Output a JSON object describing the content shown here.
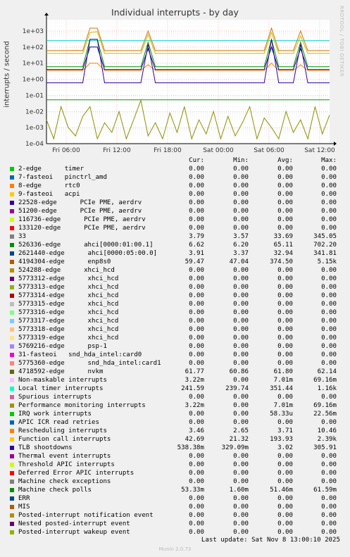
{
  "title": "Individual interrupts - by day",
  "ylabel": "interrupts / second",
  "watermark": "RRDTOOL / TOBI OETIKER",
  "footer": "Last update: Sat Nov  8 13:00:10 2025",
  "munin": "Munin 2.0.73",
  "chart_data": {
    "type": "line",
    "title": "Individual interrupts - by day",
    "ylabel": "interrupts / second",
    "yscale": "log",
    "ylim": [
      0.0001,
      5000
    ],
    "y_ticks": [
      "1e-04",
      "1e-03",
      "1e-02",
      "1e-01",
      "1e+00",
      "1e+01",
      "1e+02",
      "1e+03"
    ],
    "x_ticks": [
      "Fri 06:00",
      "Fri 12:00",
      "Fri 18:00",
      "Sat 00:00",
      "Sat 06:00",
      "Sat 12:00"
    ],
    "grid": true,
    "series": [
      {
        "name": "4194304-edge enp8s0",
        "color": "#CC7700",
        "values": [
          60,
          60,
          60,
          60,
          62,
          60,
          1500,
          1500,
          60,
          60,
          60,
          60,
          60,
          60,
          1000,
          60,
          60,
          60,
          60,
          60,
          60,
          60,
          60,
          60,
          60,
          60,
          60,
          60,
          60,
          60,
          60,
          1500,
          60,
          60,
          60,
          1000,
          60,
          60,
          60,
          60
        ]
      },
      {
        "name": "Local timer interrupts",
        "color": "#00CCCC",
        "values": [
          250,
          250,
          250,
          250,
          250,
          250,
          250,
          250,
          250,
          250,
          250,
          250,
          250,
          250,
          250,
          250,
          250,
          250,
          250,
          250,
          250,
          250,
          250,
          250,
          250,
          250,
          250,
          250,
          250,
          250,
          250,
          250,
          250,
          250,
          250,
          250,
          250,
          250,
          250,
          250
        ]
      },
      {
        "name": "Function call interrupts",
        "color": "#CCBB00",
        "values": [
          40,
          40,
          40,
          40,
          40,
          40,
          800,
          900,
          40,
          40,
          40,
          40,
          40,
          40,
          600,
          40,
          40,
          40,
          40,
          40,
          40,
          40,
          40,
          40,
          40,
          40,
          40,
          40,
          40,
          40,
          40,
          800,
          40,
          40,
          40,
          500,
          40,
          40,
          40,
          40
        ]
      },
      {
        "name": "526336-edge ahci[0000:01:00.1]",
        "color": "#008F00",
        "values": [
          6,
          6,
          6,
          6,
          6,
          6,
          300,
          300,
          6,
          6,
          6,
          6,
          6,
          6,
          200,
          6,
          6,
          6,
          6,
          6,
          6,
          6,
          6,
          6,
          6,
          6,
          6,
          6,
          6,
          6,
          6,
          300,
          6,
          6,
          6,
          200,
          6,
          6,
          6,
          6
        ]
      },
      {
        "name": "33",
        "color": "#00007F",
        "values": [
          4,
          4,
          4,
          4,
          4,
          4,
          100,
          100,
          4,
          4,
          4,
          4,
          4,
          4,
          80,
          4,
          4,
          4,
          4,
          4,
          4,
          4,
          4,
          4,
          4,
          4,
          4,
          4,
          4,
          4,
          4,
          100,
          4,
          4,
          4,
          80,
          4,
          4,
          4,
          4
        ]
      },
      {
        "name": "Rescheduling interrupts",
        "color": "#FF8000",
        "values": [
          3.5,
          3.5,
          3.5,
          3.5,
          3.5,
          3.5,
          10,
          10,
          3.5,
          3.5,
          3.5,
          3.5,
          3.5,
          3.5,
          8,
          3.5,
          3.5,
          3.5,
          3.5,
          3.5,
          3.5,
          3.5,
          3.5,
          3.5,
          3.5,
          3.5,
          3.5,
          3.5,
          3.5,
          3.5,
          3.5,
          10,
          3.5,
          3.5,
          3.5,
          8,
          3.5,
          3.5,
          3.5,
          3.5
        ]
      },
      {
        "name": "TLB shootdowns",
        "color": "#330099",
        "values": [
          0.6,
          0.6,
          0.6,
          0.6,
          0.6,
          0.6,
          300,
          300,
          0.6,
          0.6,
          0.6,
          0.6,
          0.6,
          0.6,
          150,
          0.6,
          0.6,
          0.6,
          0.6,
          0.6,
          0.6,
          0.6,
          0.6,
          0.6,
          0.6,
          0.6,
          0.6,
          0.6,
          0.6,
          0.6,
          0.6,
          300,
          0.6,
          0.6,
          0.6,
          150,
          0.6,
          0.6,
          0.6,
          0.6
        ]
      },
      {
        "name": "Machine check polls",
        "color": "#00A000",
        "values": [
          0.053,
          0.053,
          0.053,
          0.053,
          0.053,
          0.053,
          0.053,
          0.053,
          0.053,
          0.053,
          0.053,
          0.053,
          0.053,
          0.053,
          0.053,
          0.053,
          0.053,
          0.053,
          0.053,
          0.053,
          0.053,
          0.053,
          0.053,
          0.053,
          0.053,
          0.053,
          0.053,
          0.053,
          0.053,
          0.053,
          0.053,
          0.053,
          0.053,
          0.053,
          0.053,
          0.053,
          0.053,
          0.053,
          0.053,
          0.053
        ]
      },
      {
        "name": "Performance monitoring interrupts",
        "color": "#8F8F00",
        "values": [
          0.003,
          0.0002,
          0.02,
          0.001,
          0.0003,
          0.005,
          0.02,
          0.0002,
          0.002,
          0.0005,
          0.01,
          0.0002,
          0.003,
          0.05,
          0.0003,
          0.002,
          0.0002,
          0.008,
          0.0005,
          0.02,
          0.0002,
          0.003,
          0.0004,
          0.01,
          0.0002,
          0.005,
          0.0003,
          0.002,
          0.02,
          0.0002,
          0.004,
          0.001,
          0.0002,
          0.01,
          0.0005,
          0.003,
          0.0002,
          0.02,
          0.0004,
          0.006
        ]
      }
    ]
  },
  "legend": {
    "headers": [
      "Cur:",
      "Min:",
      "Avg:",
      "Max:"
    ],
    "rows": [
      {
        "color": "#00CC00",
        "label": "2-edge      timer",
        "cur": "0.00",
        "min": "0.00",
        "avg": "0.00",
        "max": "0.00"
      },
      {
        "color": "#0066B3",
        "label": "7-fasteoi   pinctrl_amd",
        "cur": "0.00",
        "min": "0.00",
        "avg": "0.00",
        "max": "0.00"
      },
      {
        "color": "#FF8000",
        "label": "8-edge      rtc0",
        "cur": "0.00",
        "min": "0.00",
        "avg": "0.00",
        "max": "0.00"
      },
      {
        "color": "#FFCC00",
        "label": "9-fasteoi   acpi",
        "cur": "0.00",
        "min": "0.00",
        "avg": "0.00",
        "max": "0.00"
      },
      {
        "color": "#330099",
        "label": "22528-edge      PCIe PME, aerdrv",
        "cur": "0.00",
        "min": "0.00",
        "avg": "0.00",
        "max": "0.00"
      },
      {
        "color": "#990099",
        "label": "51200-edge      PCIe PME, aerdrv",
        "cur": "0.00",
        "min": "0.00",
        "avg": "0.00",
        "max": "0.00"
      },
      {
        "color": "#CCFF00",
        "label": "116736-edge      PCIe PME, aerdrv",
        "cur": "0.00",
        "min": "0.00",
        "avg": "0.00",
        "max": "0.00"
      },
      {
        "color": "#FF0000",
        "label": "133120-edge      PCIe PME, aerdrv",
        "cur": "0.00",
        "min": "0.00",
        "avg": "0.00",
        "max": "0.00"
      },
      {
        "color": "#808080",
        "label": "33",
        "cur": "3.79",
        "min": "3.57",
        "avg": "33.69",
        "max": "345.05"
      },
      {
        "color": "#008F00",
        "label": "526336-edge      ahci[0000:01:00.1]",
        "cur": "6.62",
        "min": "6.20",
        "avg": "65.11",
        "max": "702.20"
      },
      {
        "color": "#00487D",
        "label": "2621440-edge      ahci[0000:05:00.0]",
        "cur": "3.91",
        "min": "3.37",
        "avg": "32.94",
        "max": "341.81"
      },
      {
        "color": "#B35A00",
        "label": "4194304-edge      enp8s0",
        "cur": "59.47",
        "min": "47.04",
        "avg": "374.50",
        "max": "5.15k"
      },
      {
        "color": "#B38F00",
        "label": "524288-edge      xhci_hcd",
        "cur": "0.00",
        "min": "0.00",
        "avg": "0.00",
        "max": "0.00"
      },
      {
        "color": "#6B006B",
        "label": "5773312-edge      xhci_hcd",
        "cur": "0.00",
        "min": "0.00",
        "avg": "0.00",
        "max": "0.00"
      },
      {
        "color": "#8FB300",
        "label": "5773313-edge      xhci_hcd",
        "cur": "0.00",
        "min": "0.00",
        "avg": "0.00",
        "max": "0.00"
      },
      {
        "color": "#B30000",
        "label": "5773314-edge      xhci_hcd",
        "cur": "0.00",
        "min": "0.00",
        "avg": "0.00",
        "max": "0.00"
      },
      {
        "color": "#BEBEBE",
        "label": "5773315-edge      xhci_hcd",
        "cur": "0.00",
        "min": "0.00",
        "avg": "0.00",
        "max": "0.00"
      },
      {
        "color": "#80FF80",
        "label": "5773316-edge      xhci_hcd",
        "cur": "0.00",
        "min": "0.00",
        "avg": "0.00",
        "max": "0.00"
      },
      {
        "color": "#80C9FF",
        "label": "5773317-edge      xhci_hcd",
        "cur": "0.00",
        "min": "0.00",
        "avg": "0.00",
        "max": "0.00"
      },
      {
        "color": "#FFC080",
        "label": "5773318-edge      xhci_hcd",
        "cur": "0.00",
        "min": "0.00",
        "avg": "0.00",
        "max": "0.00"
      },
      {
        "color": "#FFE680",
        "label": "5773319-edge      xhci_hcd",
        "cur": "0.00",
        "min": "0.00",
        "avg": "0.00",
        "max": "0.00"
      },
      {
        "color": "#AA80FF",
        "label": "5769216-edge      psp-1",
        "cur": "0.00",
        "min": "0.00",
        "avg": "0.00",
        "max": "0.00"
      },
      {
        "color": "#EE00CC",
        "label": "31-fasteoi   snd_hda_intel:card0",
        "cur": "0.00",
        "min": "0.00",
        "avg": "0.00",
        "max": "0.00"
      },
      {
        "color": "#FF8080",
        "label": "5775360-edge      snd_hda_intel:card1",
        "cur": "0.00",
        "min": "0.00",
        "avg": "0.00",
        "max": "0.00"
      },
      {
        "color": "#666600",
        "label": "4718592-edge      nvkm",
        "cur": "61.77",
        "min": "60.86",
        "avg": "61.80",
        "max": "62.14"
      },
      {
        "color": "#FFBFFF",
        "label": "Non-maskable interrupts",
        "cur": "3.22m",
        "min": "0.00",
        "avg": "7.01m",
        "max": "69.16m"
      },
      {
        "color": "#00FFCC",
        "label": "Local timer interrupts",
        "cur": "241.59",
        "min": "239.74",
        "avg": "351.44",
        "max": "1.16k"
      },
      {
        "color": "#CC6699",
        "label": "Spurious interrupts",
        "cur": "0.00",
        "min": "0.00",
        "avg": "0.00",
        "max": "0.00"
      },
      {
        "color": "#999900",
        "label": "Performance monitoring interrupts",
        "cur": "3.22m",
        "min": "0.00",
        "avg": "7.01m",
        "max": "69.16m"
      },
      {
        "color": "#00CC00",
        "label": "IRQ work interrupts",
        "cur": "0.00",
        "min": "0.00",
        "avg": "58.33u",
        "max": "22.56m"
      },
      {
        "color": "#0066B3",
        "label": "APIC ICR read retries",
        "cur": "0.00",
        "min": "0.00",
        "avg": "0.00",
        "max": "0.00"
      },
      {
        "color": "#FF8000",
        "label": "Rescheduling interrupts",
        "cur": "3.46",
        "min": "2.65",
        "avg": "3.71",
        "max": "10.46"
      },
      {
        "color": "#FFCC00",
        "label": "Function call interrupts",
        "cur": "42.69",
        "min": "21.32",
        "avg": "193.93",
        "max": "2.39k"
      },
      {
        "color": "#330099",
        "label": "TLB shootdowns",
        "cur": "538.38m",
        "min": "329.09m",
        "avg": "3.02",
        "max": "305.91"
      },
      {
        "color": "#990099",
        "label": "Thermal event interrupts",
        "cur": "0.00",
        "min": "0.00",
        "avg": "0.00",
        "max": "0.00"
      },
      {
        "color": "#CCFF00",
        "label": "Threshold APIC interrupts",
        "cur": "0.00",
        "min": "0.00",
        "avg": "0.00",
        "max": "0.00"
      },
      {
        "color": "#FF0000",
        "label": "Deferred Error APIC interrupts",
        "cur": "0.00",
        "min": "0.00",
        "avg": "0.00",
        "max": "0.00"
      },
      {
        "color": "#808080",
        "label": "Machine check exceptions",
        "cur": "0.00",
        "min": "0.00",
        "avg": "0.00",
        "max": "0.00"
      },
      {
        "color": "#008F00",
        "label": "Machine check polls",
        "cur": "53.33m",
        "min": "1.60m",
        "avg": "51.46m",
        "max": "61.59m"
      },
      {
        "color": "#00487D",
        "label": "ERR",
        "cur": "0.00",
        "min": "0.00",
        "avg": "0.00",
        "max": "0.00"
      },
      {
        "color": "#B35A00",
        "label": "MIS",
        "cur": "0.00",
        "min": "0.00",
        "avg": "0.00",
        "max": "0.00"
      },
      {
        "color": "#B38F00",
        "label": "Posted-interrupt notification event",
        "cur": "0.00",
        "min": "0.00",
        "avg": "0.00",
        "max": "0.00"
      },
      {
        "color": "#6B006B",
        "label": "Nested posted-interrupt event",
        "cur": "0.00",
        "min": "0.00",
        "avg": "0.00",
        "max": "0.00"
      },
      {
        "color": "#8FB300",
        "label": "Posted-interrupt wakeup event",
        "cur": "0.00",
        "min": "0.00",
        "avg": "0.00",
        "max": "0.00"
      }
    ]
  }
}
